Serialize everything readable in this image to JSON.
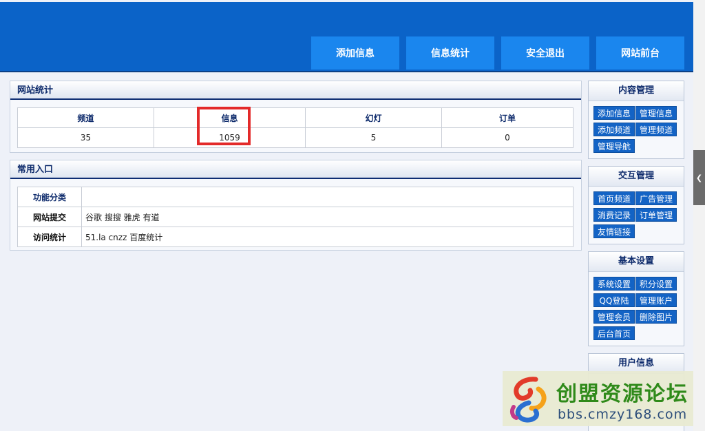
{
  "header": {
    "nav": [
      "添加信息",
      "信息统计",
      "安全退出",
      "网站前台"
    ]
  },
  "stats_panel": {
    "title": "网站统计",
    "headers": [
      "频道",
      "信息",
      "幻灯",
      "订单"
    ],
    "values": [
      "35",
      "1059",
      "5",
      "0"
    ]
  },
  "links_panel": {
    "title": "常用入口",
    "rows": [
      {
        "label": "功能分类",
        "value": ""
      },
      {
        "label": "网站提交",
        "value": "谷歌 搜搜 雅虎 有道"
      },
      {
        "label": "访问统计",
        "value": "51.la cnzz 百度统计"
      }
    ]
  },
  "sidebar": {
    "content": {
      "title": "内容管理",
      "buttons": [
        "添加信息",
        "管理信息",
        "添加频道",
        "管理频道",
        "管理导航"
      ]
    },
    "interaction": {
      "title": "交互管理",
      "buttons": [
        "首页频道",
        "广告管理",
        "消费记录",
        "订单管理",
        "友情链接"
      ]
    },
    "basic": {
      "title": "基本设置",
      "buttons": [
        "系统设置",
        "积分设置",
        "QQ登陆",
        "管理账户",
        "管理会员",
        "删除图片",
        "后台首页"
      ]
    },
    "user": {
      "title": "用户信息"
    }
  },
  "watermark": {
    "title": "创盟资源论坛",
    "url": "bbs.cmzy168.com"
  },
  "scrollbar": {
    "glyph": "❮"
  },
  "colors": {
    "header": "#0b63c8",
    "nav_button": "#1a86ee",
    "side_button": "#1363c5",
    "highlight": "#e32a2a"
  }
}
